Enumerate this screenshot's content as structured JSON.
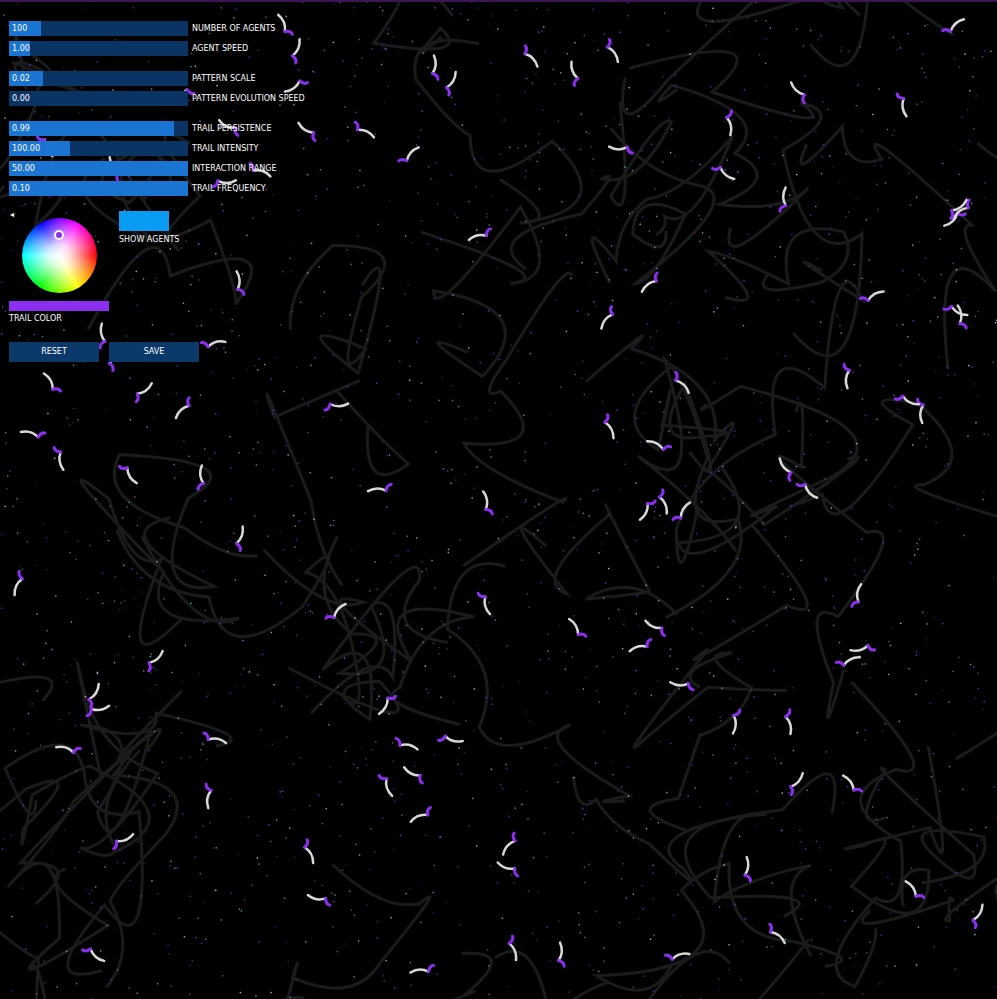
{
  "controls": {
    "slider_groups": [
      [
        {
          "label": "NUMBER OF AGENTS",
          "value": "100",
          "level": 0.18
        },
        {
          "label": "AGENT SPEED",
          "value": "1.00",
          "level": 0.12
        }
      ],
      [
        {
          "label": "PATTERN SCALE",
          "value": "0.02",
          "level": 0.19
        },
        {
          "label": "PATTERN EVOLUTION SPEED",
          "value": "0.00",
          "level": 0
        }
      ],
      [
        {
          "label": "TRAIL PERSISTENCE",
          "value": "0.99",
          "level": 0.92
        },
        {
          "label": "TRAIL INTENSITY",
          "value": "100.00",
          "level": 0.34
        },
        {
          "label": "INTERACTION RANGE",
          "value": "50.00",
          "level": 1
        },
        {
          "label": "TRAIL FREQUENCY",
          "value": "0.10",
          "level": 1
        }
      ]
    ],
    "collapse_icon": "◂",
    "show_agents": {
      "label": "SHOW AGENTS",
      "on": true
    },
    "trail_color": {
      "label": "TRAIL COLOR",
      "color": "#8c2ff0"
    },
    "buttons": [
      "RESET",
      "SAVE"
    ]
  }
}
